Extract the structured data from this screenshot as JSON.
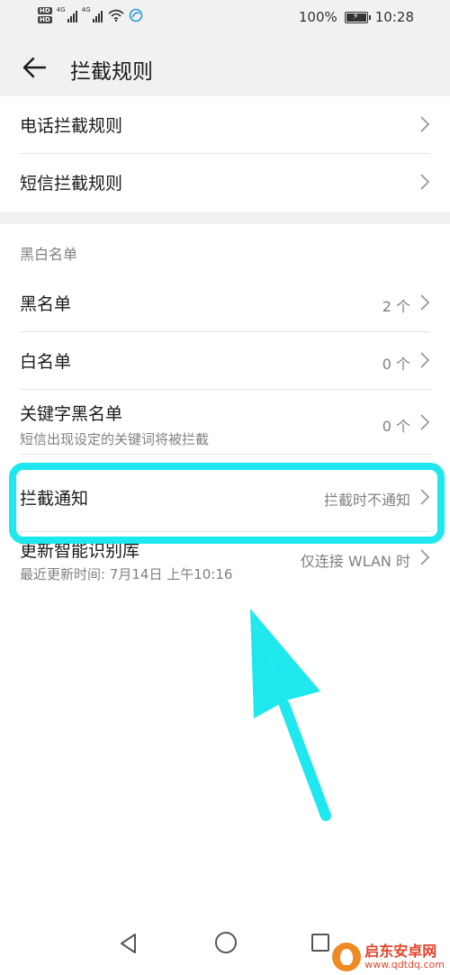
{
  "status_bar": {
    "hd_1": "HD",
    "hd_2": "HD",
    "net_1": "4G",
    "net_2": "4G",
    "battery_pct": "100%",
    "battery_level": 1.0,
    "time": "10:28"
  },
  "header": {
    "title": "拦截规则",
    "back_icon": "arrow-left-icon"
  },
  "rules": {
    "call_rule_label": "电话拦截规则",
    "sms_rule_label": "短信拦截规则"
  },
  "lists": {
    "section_title": "黑白名单",
    "blacklist_label": "黑名单",
    "blacklist_count": "2 个",
    "whitelist_label": "白名单",
    "whitelist_count": "0 个",
    "keyword_label": "关键字黑名单",
    "keyword_sub": "短信出现设定的关键词将被拦截",
    "keyword_count": "0 个"
  },
  "notify": {
    "label": "拦截通知",
    "value": "拦截时不通知"
  },
  "update": {
    "label": "更新智能识别库",
    "sub": "最近更新时间: 7月14日 上午10:16",
    "value": "仅连接 WLAN 时"
  },
  "annotation": {
    "highlight_color": "#1ee8ee",
    "arrow_color": "#1ee8ee"
  },
  "watermark": {
    "name": "启东安卓网",
    "url": "www.qdtdq.com"
  },
  "colors": {
    "background": "#ffffff",
    "header_bg": "#f1f1f1",
    "secondary_text": "#808080"
  }
}
